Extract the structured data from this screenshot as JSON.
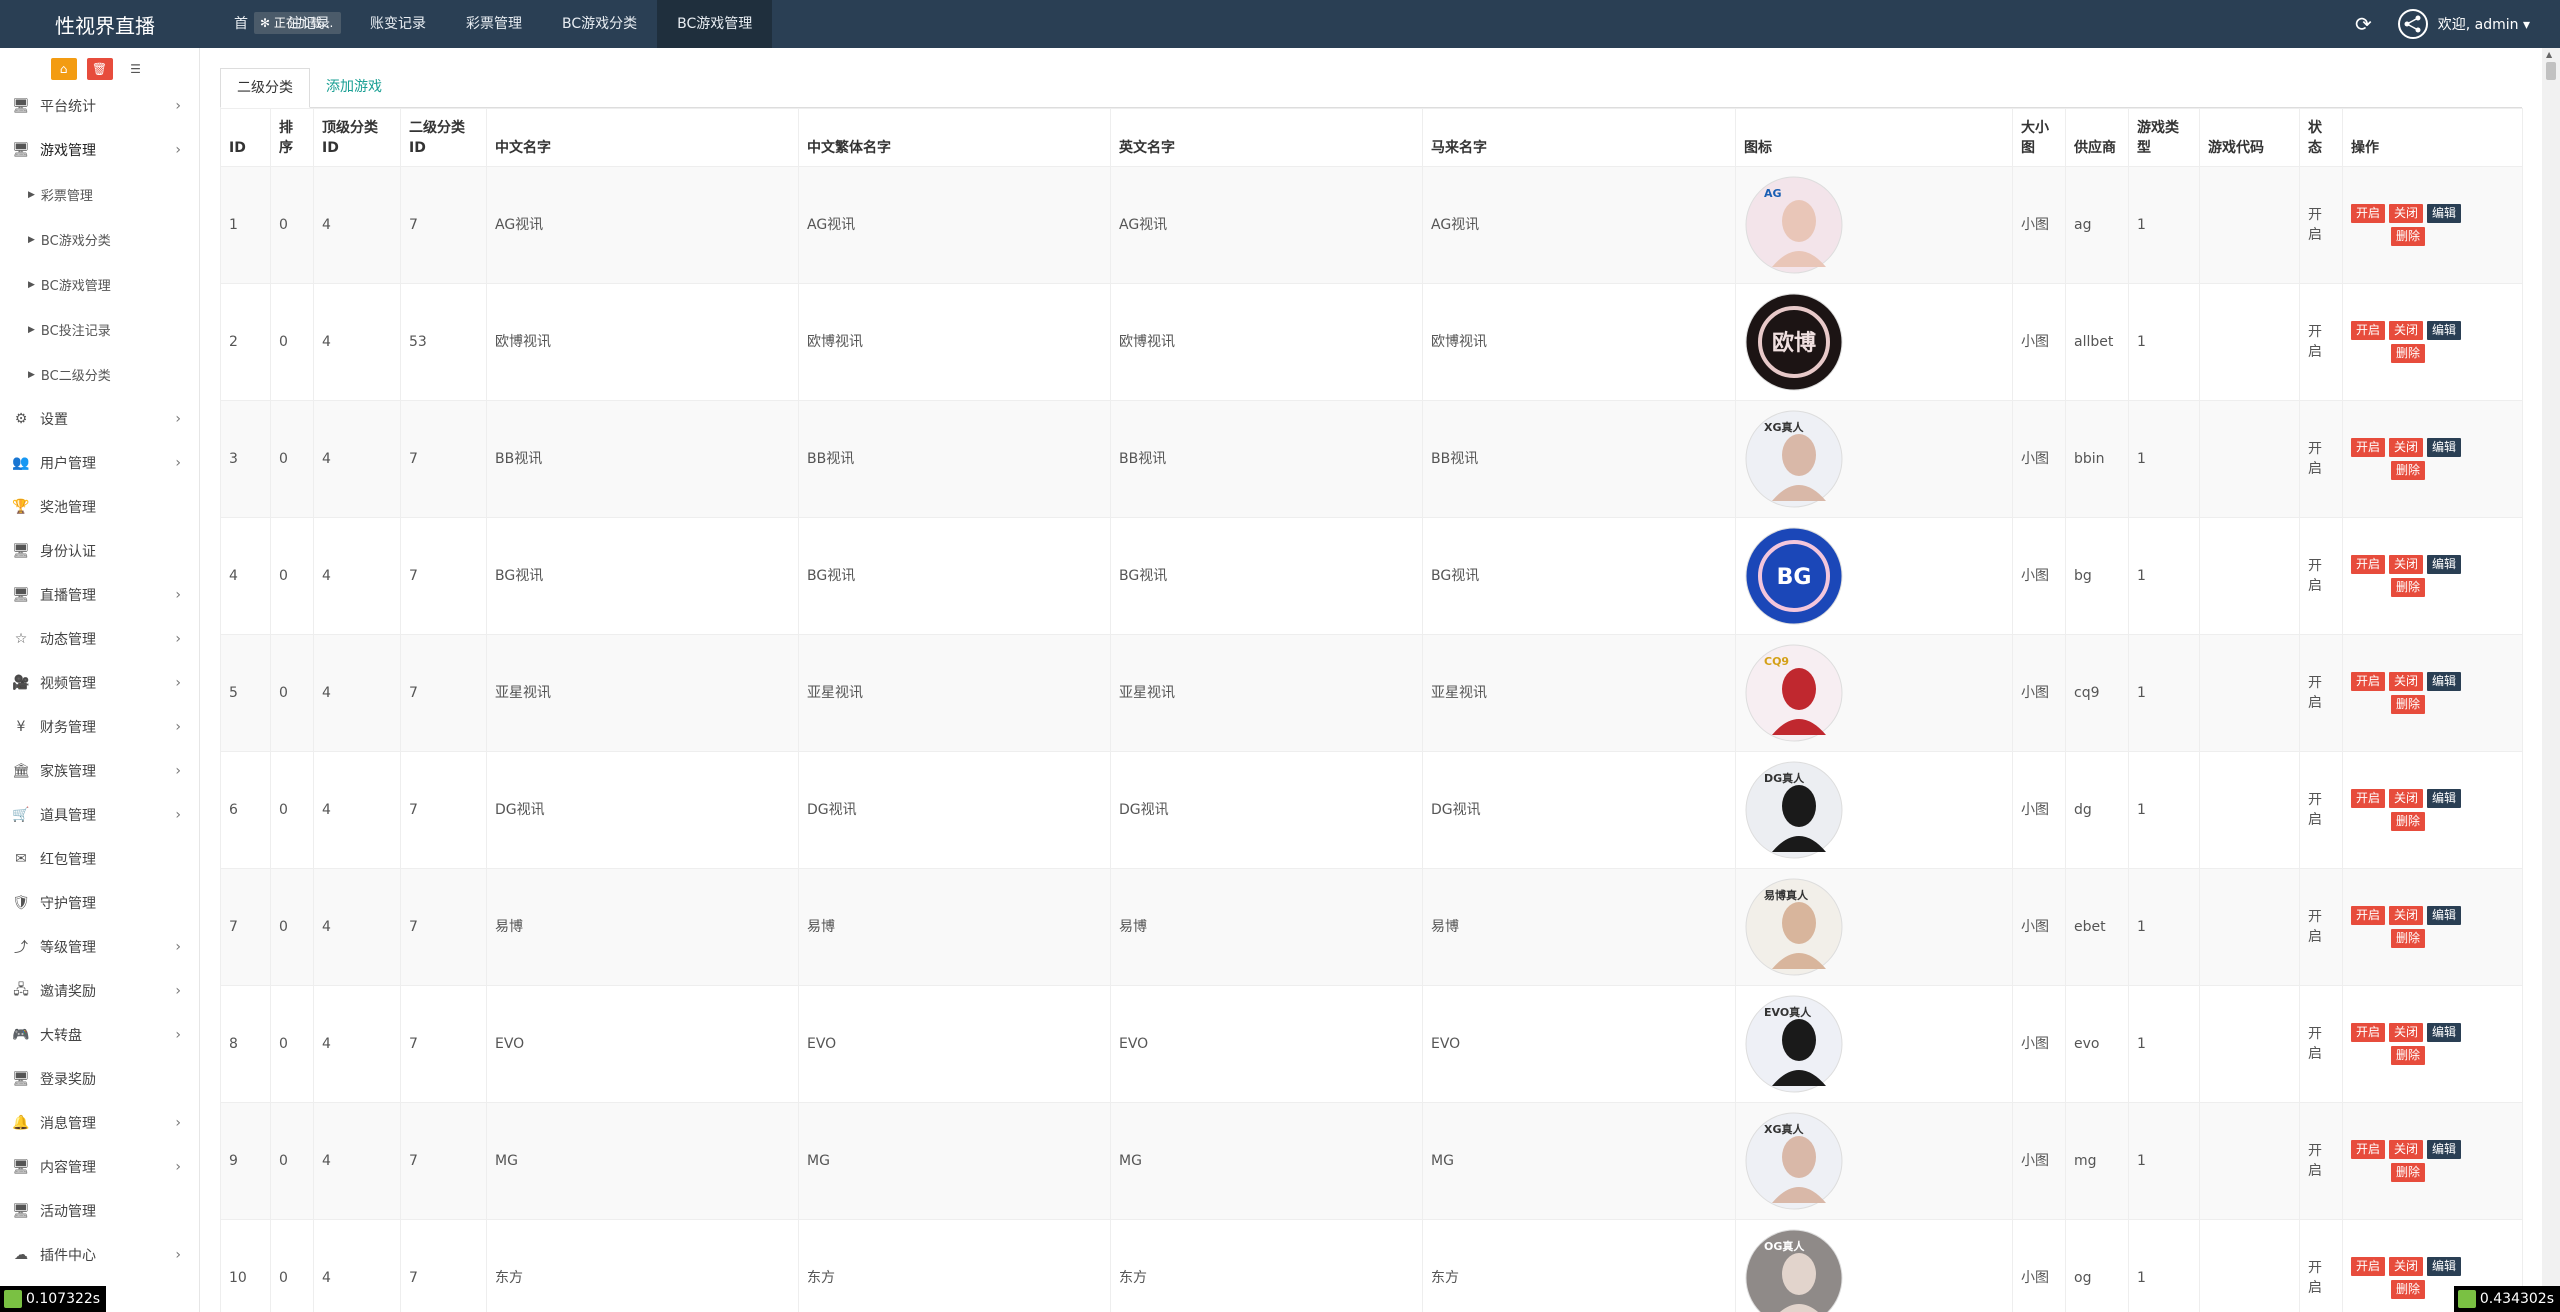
{
  "app": {
    "title": "性视界直播",
    "loading_text": "正在加载..."
  },
  "topnav": [
    {
      "label": "首",
      "active": false
    },
    {
      "label": "注记录",
      "active": false
    },
    {
      "label": "账变记录",
      "active": false
    },
    {
      "label": "彩票管理",
      "active": false
    },
    {
      "label": "BC游戏分类",
      "active": false
    },
    {
      "label": "BC游戏管理",
      "active": true
    }
  ],
  "user": {
    "welcome": "欢迎, admin ▾"
  },
  "sidebar": {
    "items": [
      {
        "label": "平台统计",
        "icon": "monitor-icon",
        "glyph": "🖥",
        "has_children": true
      },
      {
        "label": "游戏管理",
        "icon": "monitor-icon",
        "glyph": "🖥",
        "has_children": true,
        "open": true,
        "children": [
          "彩票管理",
          "BC游戏分类",
          "BC游戏管理",
          "BC投注记录",
          "BC二级分类"
        ]
      },
      {
        "label": "设置",
        "icon": "gears-icon",
        "glyph": "⚙",
        "has_children": true
      },
      {
        "label": "用户管理",
        "icon": "users-icon",
        "glyph": "👥",
        "has_children": true
      },
      {
        "label": "奖池管理",
        "icon": "trophy-icon",
        "glyph": "🏆",
        "has_children": false
      },
      {
        "label": "身份认证",
        "icon": "monitor-icon",
        "glyph": "🖥",
        "has_children": false
      },
      {
        "label": "直播管理",
        "icon": "monitor-icon",
        "glyph": "🖥",
        "has_children": true
      },
      {
        "label": "动态管理",
        "icon": "star-icon",
        "glyph": "☆",
        "has_children": true
      },
      {
        "label": "视频管理",
        "icon": "video-icon",
        "glyph": "🎥",
        "has_children": true
      },
      {
        "label": "财务管理",
        "icon": "yen-icon",
        "glyph": "¥",
        "has_children": true
      },
      {
        "label": "家族管理",
        "icon": "bank-icon",
        "glyph": "🏛",
        "has_children": true
      },
      {
        "label": "道具管理",
        "icon": "cart-icon",
        "glyph": "🛒",
        "has_children": true
      },
      {
        "label": "红包管理",
        "icon": "envelope-icon",
        "glyph": "✉",
        "has_children": false
      },
      {
        "label": "守护管理",
        "icon": "shield-icon",
        "glyph": "🛡",
        "has_children": false
      },
      {
        "label": "等级管理",
        "icon": "level-up-icon",
        "glyph": "⤴",
        "has_children": true
      },
      {
        "label": "邀请奖励",
        "icon": "sitemap-icon",
        "glyph": "🖧",
        "has_children": true
      },
      {
        "label": "大转盘",
        "icon": "gamepad-icon",
        "glyph": "🎮",
        "has_children": true
      },
      {
        "label": "登录奖励",
        "icon": "monitor-icon",
        "glyph": "🖥",
        "has_children": false
      },
      {
        "label": "消息管理",
        "icon": "bell-icon",
        "glyph": "🔔",
        "has_children": true
      },
      {
        "label": "内容管理",
        "icon": "monitor-icon",
        "glyph": "🖥",
        "has_children": true
      },
      {
        "label": "活动管理",
        "icon": "monitor-icon",
        "glyph": "🖥",
        "has_children": false
      },
      {
        "label": "插件中心",
        "icon": "cloud-icon",
        "glyph": "☁",
        "has_children": true
      }
    ]
  },
  "tabs": [
    {
      "label": "二级分类",
      "active": true
    },
    {
      "label": "添加游戏",
      "active": false
    }
  ],
  "table": {
    "columns": [
      "ID",
      "排序",
      "顶级分类ID",
      "二级分类ID",
      "中文名字",
      "中文繁体名字",
      "英文名字",
      "马来名字",
      "图标",
      "大小图",
      "供应商",
      "游戏类型",
      "游戏代码",
      "状态",
      "操作"
    ],
    "rows": [
      {
        "id": "1",
        "sort": "0",
        "top": "4",
        "sub": "7",
        "zh": "AG视讯",
        "zht": "AG视讯",
        "en": "AG视讯",
        "ms": "AG视讯",
        "size": "小图",
        "vendor": "ag",
        "type": "1",
        "code": "",
        "status": "开启",
        "icon": {
          "kind": "photo",
          "bg": "#f3e4ea",
          "accent": "#e9c6b8",
          "text": "AG",
          "text_color": "#1a5fb4"
        }
      },
      {
        "id": "2",
        "sort": "0",
        "top": "4",
        "sub": "53",
        "zh": "欧博视讯",
        "zht": "欧博视讯",
        "en": "欧博视讯",
        "ms": "欧博视讯",
        "size": "小图",
        "vendor": "allbet",
        "type": "1",
        "code": "",
        "status": "开启",
        "icon": {
          "kind": "logo",
          "bg": "#1c1414",
          "accent": "#e8c9c9",
          "text": "欧博",
          "text_color": "#f0e0e0"
        }
      },
      {
        "id": "3",
        "sort": "0",
        "top": "4",
        "sub": "7",
        "zh": "BB视讯",
        "zht": "BB视讯",
        "en": "BB视讯",
        "ms": "BB视讯",
        "size": "小图",
        "vendor": "bbin",
        "type": "1",
        "code": "",
        "status": "开启",
        "icon": {
          "kind": "photo",
          "bg": "#eef0f5",
          "accent": "#d9b8a8",
          "text": "XG真人",
          "text_color": "#333"
        }
      },
      {
        "id": "4",
        "sort": "0",
        "top": "4",
        "sub": "7",
        "zh": "BG视讯",
        "zht": "BG视讯",
        "en": "BG视讯",
        "ms": "BG视讯",
        "size": "小图",
        "vendor": "bg",
        "type": "1",
        "code": "",
        "status": "开启",
        "icon": {
          "kind": "logo",
          "bg": "#1b47b8",
          "accent": "#f4c6dc",
          "text": "BG",
          "text_color": "#ffffff"
        }
      },
      {
        "id": "5",
        "sort": "0",
        "top": "4",
        "sub": "7",
        "zh": "亚星视讯",
        "zht": "亚星视讯",
        "en": "亚星视讯",
        "ms": "亚星视讯",
        "size": "小图",
        "vendor": "cq9",
        "type": "1",
        "code": "",
        "status": "开启",
        "icon": {
          "kind": "photo",
          "bg": "#f7eef2",
          "accent": "#c0282f",
          "text": "CQ9",
          "text_color": "#d4a017"
        }
      },
      {
        "id": "6",
        "sort": "0",
        "top": "4",
        "sub": "7",
        "zh": "DG视讯",
        "zht": "DG视讯",
        "en": "DG视讯",
        "ms": "DG视讯",
        "size": "小图",
        "vendor": "dg",
        "type": "1",
        "code": "",
        "status": "开启",
        "icon": {
          "kind": "photo",
          "bg": "#eceef2",
          "accent": "#1a1a1a",
          "text": "DG真人",
          "text_color": "#333"
        }
      },
      {
        "id": "7",
        "sort": "0",
        "top": "4",
        "sub": "7",
        "zh": "易博",
        "zht": "易博",
        "en": "易博",
        "ms": "易博",
        "size": "小图",
        "vendor": "ebet",
        "type": "1",
        "code": "",
        "status": "开启",
        "icon": {
          "kind": "photo",
          "bg": "#f2efe9",
          "accent": "#d8b59c",
          "text": "易博真人",
          "text_color": "#333"
        }
      },
      {
        "id": "8",
        "sort": "0",
        "top": "4",
        "sub": "7",
        "zh": "EVO",
        "zht": "EVO",
        "en": "EVO",
        "ms": "EVO",
        "size": "小图",
        "vendor": "evo",
        "type": "1",
        "code": "",
        "status": "开启",
        "icon": {
          "kind": "photo",
          "bg": "#eef0f6",
          "accent": "#1a1a1a",
          "text": "EVO真人",
          "text_color": "#333"
        }
      },
      {
        "id": "9",
        "sort": "0",
        "top": "4",
        "sub": "7",
        "zh": "MG",
        "zht": "MG",
        "en": "MG",
        "ms": "MG",
        "size": "小图",
        "vendor": "mg",
        "type": "1",
        "code": "",
        "status": "开启",
        "icon": {
          "kind": "photo",
          "bg": "#eef0f5",
          "accent": "#d9b8a8",
          "text": "XG真人",
          "text_color": "#333"
        }
      },
      {
        "id": "10",
        "sort": "0",
        "top": "4",
        "sub": "7",
        "zh": "东方",
        "zht": "东方",
        "en": "东方",
        "ms": "东方",
        "size": "小图",
        "vendor": "og",
        "type": "1",
        "code": "",
        "status": "开启",
        "icon": {
          "kind": "photo",
          "bg": "#8f8a88",
          "accent": "#e2d4cc",
          "text": "OG真人",
          "text_color": "#fff"
        }
      }
    ],
    "actions": {
      "enable": "开启",
      "disable": "关闭",
      "edit": "编辑",
      "delete": "删除"
    }
  },
  "timers": {
    "left": "0.107322s",
    "right": "0.434302s"
  },
  "colors": {
    "topbar": "#2a3f54",
    "danger": "#e74c3c",
    "dark_button": "#2a3f54",
    "link": "#1aa094"
  }
}
